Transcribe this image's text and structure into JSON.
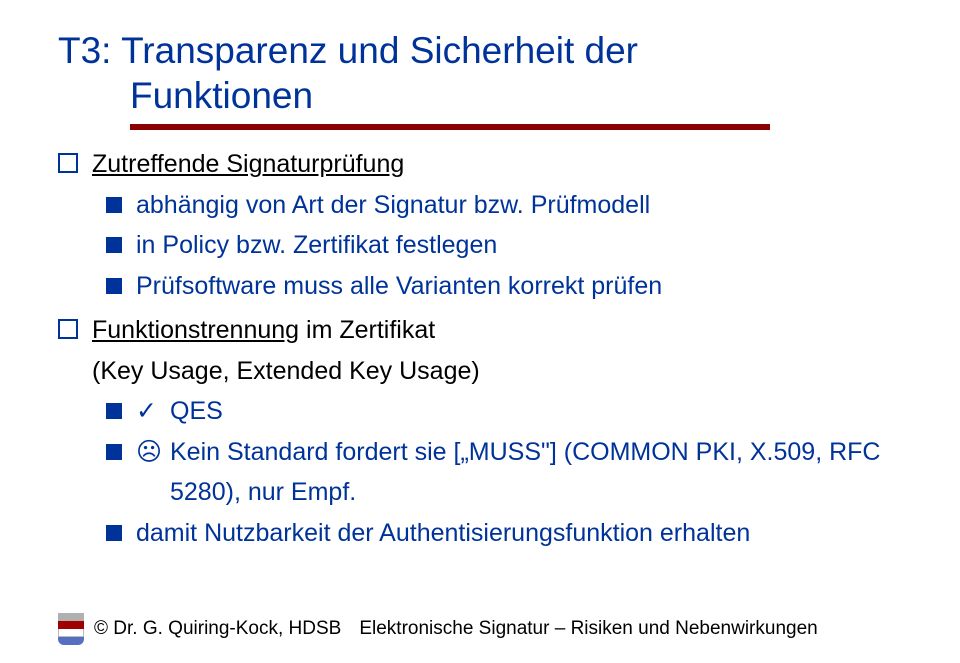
{
  "title": {
    "line1": "T3: Transparenz und Sicherheit der",
    "line2": "Funktionen"
  },
  "body": {
    "items": [
      {
        "type": "lvl1",
        "underline": "Zutreffende Signaturprüfung"
      },
      {
        "type": "lvl2",
        "text": "abhängig von Art der Signatur bzw. Prüfmodell"
      },
      {
        "type": "lvl2",
        "text": "in Policy bzw. Zertifikat festlegen"
      },
      {
        "type": "lvl2",
        "text": "Prüfsoftware muss alle Varianten korrekt prüfen"
      },
      {
        "type": "lvl1b",
        "underline": "Funktionstrennung",
        "rest": " im Zertifikat",
        "paren": "(Key Usage, Extended Key Usage)"
      },
      {
        "type": "lvl3-check",
        "text": "QES"
      },
      {
        "type": "lvl3-sad",
        "text": "Kein Standard fordert sie [„MUSS\"] (COMMON PKI, X.509, RFC 5280), nur Empf."
      },
      {
        "type": "lvl2",
        "text": "damit Nutzbarkeit der Authentisierungsfunktion erhalten"
      }
    ]
  },
  "footer": {
    "copyright": "© Dr. G. Quiring-Kock, HDSB",
    "caption": "Elektronische Signatur – Risiken und Nebenwirkungen"
  }
}
